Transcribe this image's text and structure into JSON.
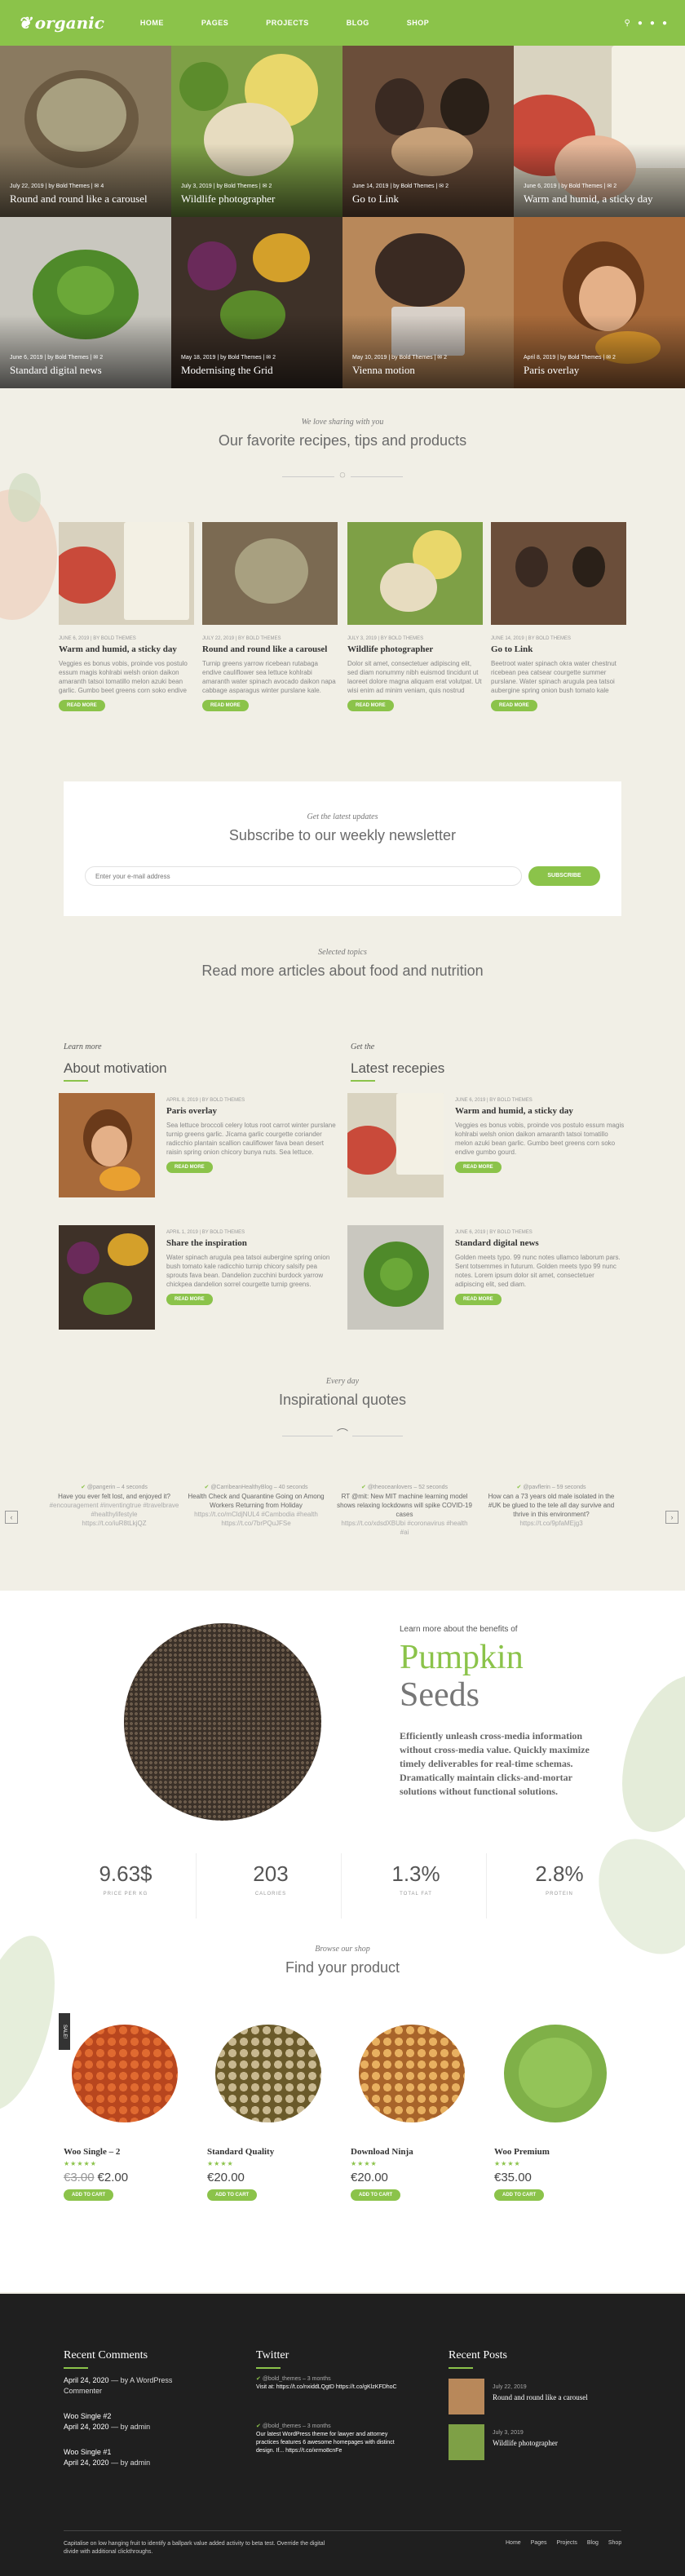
{
  "header": {
    "logo": "organic",
    "nav": [
      "HOME",
      "PAGES",
      "PROJECTS",
      "BLOG",
      "SHOP"
    ]
  },
  "hero": [
    {
      "date": "July 22, 2019",
      "author": "by Bold Themes",
      "comments": "4",
      "title": "Round and round like a carousel"
    },
    {
      "date": "July 3, 2019",
      "author": "by Bold Themes",
      "comments": "2",
      "title": "Wildlife photographer"
    },
    {
      "date": "June 14, 2019",
      "author": "by Bold Themes",
      "comments": "2",
      "title": "Go to Link"
    },
    {
      "date": "June 6, 2019",
      "author": "by Bold Themes",
      "comments": "2",
      "title": "Warm and humid, a sticky day"
    },
    {
      "date": "June 6, 2019",
      "author": "by Bold Themes",
      "comments": "2",
      "title": "Standard digital news"
    },
    {
      "date": "May 18, 2019",
      "author": "by Bold Themes",
      "comments": "2",
      "title": "Modernising the Grid"
    },
    {
      "date": "May 10, 2019",
      "author": "by Bold Themes",
      "comments": "2",
      "title": "Vienna motion"
    },
    {
      "date": "April 8, 2019",
      "author": "by Bold Themes",
      "comments": "2",
      "title": "Paris overlay"
    }
  ],
  "favorites": {
    "kicker": "We love sharing with you",
    "title": "Our favorite recipes, tips and products",
    "cards": [
      {
        "meta": "JUNE 6, 2019 | BY BOLD THEMES",
        "title": "Warm and humid, a sticky day",
        "text": "Veggies es bonus vobis, proinde vos postulo essum magis kohlrabi welsh onion daikon amaranth tatsoi tomatillo melon azuki bean garlic. Gumbo beet greens corn soko endive gumbo gourd. Parsley shallot courgette tatsoi.",
        "button": "READ MORE"
      },
      {
        "meta": "JULY 22, 2019 | BY BOLD THEMES",
        "title": "Round and round like a carousel",
        "text": "Turnip greens yarrow ricebean rutabaga endive cauliflower sea lettuce kohlrabi amaranth water spinach avocado daikon napa cabbage asparagus winter purslane kale. Celery potato scallion desert raisin horseradish spinach.",
        "button": "READ MORE"
      },
      {
        "meta": "JULY 3, 2019 | BY BOLD THEMES",
        "title": "Wildlife photographer",
        "text": "Dolor sit amet, consectetuer adipiscing elit, sed diam nonummy nibh euismod tincidunt ut laoreet dolore magna aliquam erat volutpat. Ut wisi enim ad minim veniam, quis nostrud exerci tation ullamcorper suscipit lobortis nisl ut aliquip ex ea commodo consequat.",
        "button": "READ MORE"
      },
      {
        "meta": "JUNE 14, 2019 | BY BOLD THEMES",
        "title": "Go to Link",
        "text": "Beetroot water spinach okra water chestnut ricebean pea catsear courgette summer purslane. Water spinach arugula pea tatsoi aubergine spring onion bush tomato kale radicchio turnip chicory salsify pea sprouts fava bean.",
        "button": "READ MORE"
      }
    ]
  },
  "newsletter": {
    "kicker": "Get the latest updates",
    "title": "Subscribe to our weekly newsletter",
    "placeholder": "Enter your e-mail address",
    "button": "SUBSCRIBE"
  },
  "more": {
    "kicker": "Selected topics",
    "title": "Read more articles about food and nutrition",
    "left": {
      "kicker": "Learn more",
      "title": "About motivation",
      "items": [
        {
          "meta": "APRIL 8, 2019 | BY BOLD THEMES",
          "title": "Paris overlay",
          "text": "Sea lettuce broccoli celery lotus root carrot winter purslane turnip greens garlic. Jícama garlic courgette coriander radicchio plantain scallion cauliflower fava bean desert raisin spring onion chicory bunya nuts. Sea lettuce.",
          "button": "READ MORE"
        },
        {
          "meta": "APRIL 1, 2019 | BY BOLD THEMES",
          "title": "Share the inspiration",
          "text": "Water spinach arugula pea tatsoi aubergine spring onion bush tomato kale radicchio turnip chicory salsify pea sprouts fava bean. Dandelion zucchini burdock yarrow chickpea dandelion sorrel courgette turnip greens.",
          "button": "READ MORE"
        }
      ]
    },
    "right": {
      "kicker": "Get the",
      "title": "Latest recepies",
      "items": [
        {
          "meta": "JUNE 6, 2019 | BY BOLD THEMES",
          "title": "Warm and humid, a sticky day",
          "text": "Veggies es bonus vobis, proinde vos postulo essum magis kohlrabi welsh onion daikon amaranth tatsoi tomatillo melon azuki bean garlic. Gumbo beet greens corn soko endive gumbo gourd.",
          "button": "READ MORE"
        },
        {
          "meta": "JUNE 6, 2019 | BY BOLD THEMES",
          "title": "Standard digital news",
          "text": "Golden meets typo. 99 nunc notes ullamco laborum pars. Sent totsemmes in futurum. Golden meets typo 99 nunc notes. Lorem ipsum dolor sit amet, consectetuer adipiscing elit, sed diam.",
          "button": "READ MORE"
        }
      ]
    }
  },
  "quotes": {
    "kicker": "Every day",
    "title": "Inspirational quotes",
    "items": [
      {
        "user": "@pangerin – 4 seconds",
        "text": "Have you ever felt lost, and enjoyed it?",
        "tags": "#encouragement #inventingtrue #travelbrave #healthylifestyle",
        "link": "https://t.co/iuR8tLkjQZ"
      },
      {
        "user": "@CarribeanHealthyBlog – 40 seconds",
        "text": "Health Check and Quarantine Going on Among Workers Returning from Holiday",
        "tags": "https://t.co/mCldjNUL4 #Cambodia #health",
        "link": "https://t.co/7brPQuJFSe"
      },
      {
        "user": "@theoceanlovers – 52 seconds",
        "text": "RT @mit: New MIT machine learning model shows relaxing lockdowns will spike COVID-19 cases",
        "tags": "https://t.co/xdsdXBUbi #coronavirus #health",
        "link": "#ai"
      },
      {
        "user": "@pavflerin – 59 seconds",
        "text": "How can a 73 years old male isolated in the #UK be glued to the tele all day survive and thrive in this environment?",
        "tags": "",
        "link": "https://t.co/9pfaMEjg3"
      }
    ]
  },
  "pumpkin": {
    "intro": "Learn more about the benefits of",
    "title1": "Pumpkin",
    "title2": "Seeds",
    "text": "Efficiently unleash cross-media information without cross-media value. Quickly maximize timely deliverables for real-time schemas. Dramatically maintain clicks-and-mortar solutions without functional solutions.",
    "stats": [
      {
        "value": "9.63$",
        "label": "PRICE PER KG"
      },
      {
        "value": "203",
        "label": "CALORIES"
      },
      {
        "value": "1.3%",
        "label": "TOTAL FAT"
      },
      {
        "value": "2.8%",
        "label": "PROTEIN"
      }
    ]
  },
  "shop": {
    "kicker": "Browse our shop",
    "title": "Find your product",
    "products": [
      {
        "name": "Woo Single – 2",
        "stars": "★★★★★",
        "old": "€3.00",
        "price": "€2.00",
        "badge": "SALE!",
        "button": "ADD TO CART"
      },
      {
        "name": "Standard Quality",
        "stars": "★★★★",
        "old": "",
        "price": "€20.00",
        "badge": "",
        "button": "ADD TO CART"
      },
      {
        "name": "Download Ninja",
        "stars": "★★★★",
        "old": "",
        "price": "€20.00",
        "badge": "",
        "button": "ADD TO CART"
      },
      {
        "name": "Woo Premium",
        "stars": "★★★★",
        "old": "",
        "price": "€35.00",
        "badge": "",
        "button": "ADD TO CART"
      }
    ]
  },
  "footer": {
    "comments": {
      "title": "Recent Comments",
      "items": [
        {
          "date": "April 24, 2020",
          "by": "— by A WordPress Commenter"
        },
        {
          "title": "Woo Single #2",
          "date": "April 24, 2020",
          "by": "— by admin"
        },
        {
          "title": "Woo Single #1",
          "date": "April 24, 2020",
          "by": "— by admin"
        }
      ]
    },
    "twitter": {
      "title": "Twitter",
      "items": [
        {
          "user": "@bold_themes – 3 months",
          "text": "Visit at: https://t.co/nxiddLQgtD https://t.co/gKlzKFDhoC"
        },
        {
          "user": "@bold_themes – 3 months",
          "text": "Our latest WordPress theme for lawyer and attorney practices features 6 awesome homepages with distinct design. If... https://t.co/xrmo8cnFe"
        }
      ]
    },
    "posts": {
      "title": "Recent Posts",
      "items": [
        {
          "date": "July 22, 2019",
          "title": "Round and round like a carousel"
        },
        {
          "date": "July 3, 2019",
          "title": "Wildlife photographer"
        }
      ]
    },
    "copyright": "Capitalise on low hanging fruit to identify a ballpark value added activity to beta test. Override the digital divide with additional clickthroughs.",
    "links": [
      "Home",
      "Pages",
      "Projects",
      "Blog",
      "Shop"
    ]
  }
}
